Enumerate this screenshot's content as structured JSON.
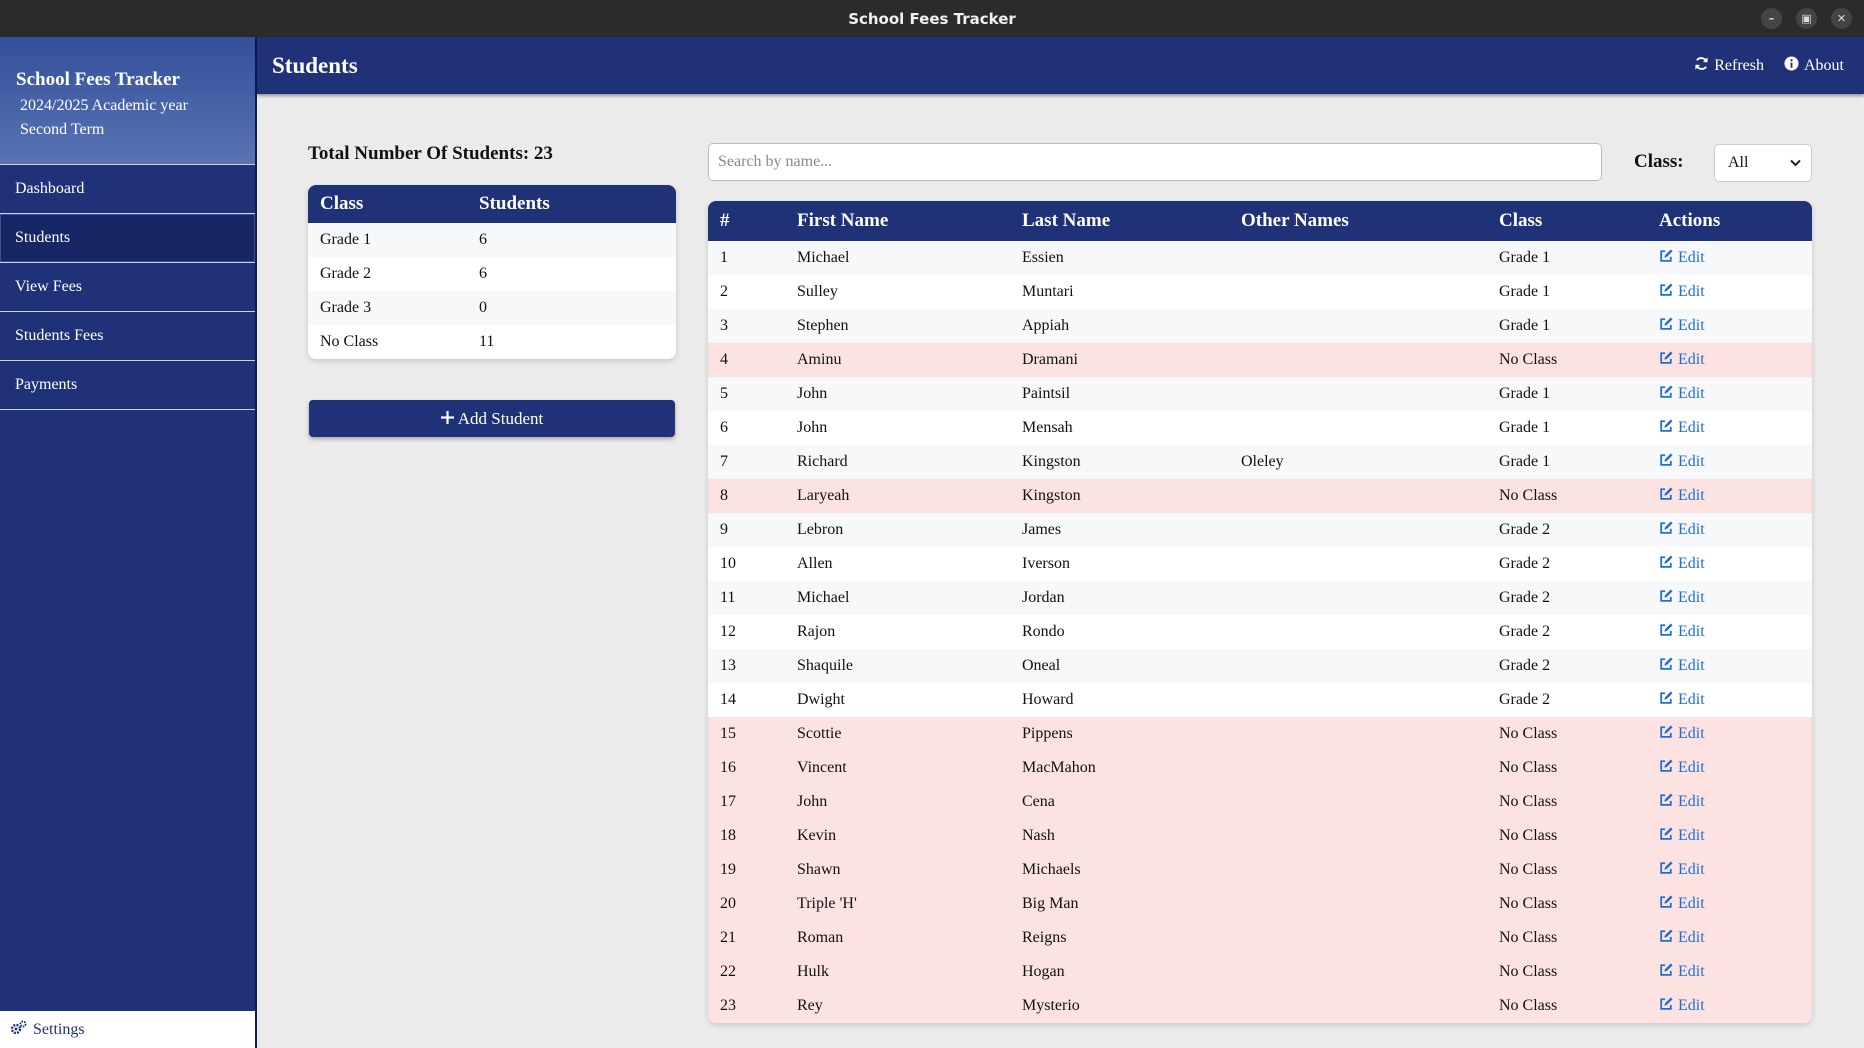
{
  "window": {
    "title": "School Fees Tracker"
  },
  "sidebar": {
    "title": "School Fees Tracker",
    "academic_year": "2024/2025 Academic year",
    "term": "Second Term",
    "items": [
      {
        "label": "Dashboard"
      },
      {
        "label": "Students",
        "active": true
      },
      {
        "label": "View Fees"
      },
      {
        "label": "Students Fees"
      },
      {
        "label": "Payments"
      }
    ],
    "settings_label": "Settings"
  },
  "header": {
    "title": "Students",
    "refresh_label": "Refresh",
    "about_label": "About"
  },
  "summary": {
    "total_label": "Total Number Of Students: 23",
    "columns": [
      "Class",
      "Students"
    ],
    "rows": [
      {
        "class": "Grade 1",
        "count": "6"
      },
      {
        "class": "Grade 2",
        "count": "6"
      },
      {
        "class": "Grade 3",
        "count": "0"
      },
      {
        "class": "No Class",
        "count": "11"
      }
    ],
    "add_button_label": "Add Student"
  },
  "filters": {
    "search_placeholder": "Search by name...",
    "class_label": "Class:",
    "class_selected": "All"
  },
  "students_table": {
    "columns": [
      "#",
      "First Name",
      "Last Name",
      "Other Names",
      "Class",
      "Actions"
    ],
    "edit_label": "Edit",
    "rows": [
      {
        "num": "1",
        "first": "Michael",
        "last": "Essien",
        "other": "",
        "class": "Grade 1"
      },
      {
        "num": "2",
        "first": "Sulley",
        "last": "Muntari",
        "other": "",
        "class": "Grade 1"
      },
      {
        "num": "3",
        "first": "Stephen",
        "last": "Appiah",
        "other": "",
        "class": "Grade 1"
      },
      {
        "num": "4",
        "first": "Aminu",
        "last": "Dramani",
        "other": "",
        "class": "No Class"
      },
      {
        "num": "5",
        "first": "John",
        "last": "Paintsil",
        "other": "",
        "class": "Grade 1"
      },
      {
        "num": "6",
        "first": "John",
        "last": "Mensah",
        "other": "",
        "class": "Grade 1"
      },
      {
        "num": "7",
        "first": "Richard",
        "last": "Kingston",
        "other": "Oleley",
        "class": "Grade 1"
      },
      {
        "num": "8",
        "first": "Laryeah",
        "last": "Kingston",
        "other": "",
        "class": "No Class"
      },
      {
        "num": "9",
        "first": "Lebron",
        "last": "James",
        "other": "",
        "class": "Grade 2"
      },
      {
        "num": "10",
        "first": "Allen",
        "last": "Iverson",
        "other": "",
        "class": "Grade 2"
      },
      {
        "num": "11",
        "first": "Michael",
        "last": "Jordan",
        "other": "",
        "class": "Grade 2"
      },
      {
        "num": "12",
        "first": "Rajon",
        "last": "Rondo",
        "other": "",
        "class": "Grade 2"
      },
      {
        "num": "13",
        "first": "Shaquile",
        "last": "Oneal",
        "other": "",
        "class": "Grade 2"
      },
      {
        "num": "14",
        "first": "Dwight",
        "last": "Howard",
        "other": "",
        "class": "Grade 2"
      },
      {
        "num": "15",
        "first": "Scottie",
        "last": "Pippens",
        "other": "",
        "class": "No Class"
      },
      {
        "num": "16",
        "first": "Vincent",
        "last": "MacMahon",
        "other": "",
        "class": "No Class"
      },
      {
        "num": "17",
        "first": "John",
        "last": "Cena",
        "other": "",
        "class": "No Class"
      },
      {
        "num": "18",
        "first": "Kevin",
        "last": "Nash",
        "other": "",
        "class": "No Class"
      },
      {
        "num": "19",
        "first": "Shawn",
        "last": "Michaels",
        "other": "",
        "class": "No Class"
      },
      {
        "num": "20",
        "first": "Triple 'H'",
        "last": "Big Man",
        "other": "",
        "class": "No Class"
      },
      {
        "num": "21",
        "first": "Roman",
        "last": "Reigns",
        "other": "",
        "class": "No Class"
      },
      {
        "num": "22",
        "first": "Hulk",
        "last": "Hogan",
        "other": "",
        "class": "No Class"
      },
      {
        "num": "23",
        "first": "Rey",
        "last": "Mysterio",
        "other": "",
        "class": "No Class"
      }
    ]
  },
  "colors": {
    "primary": "#1f3278",
    "no_class_row": "#fde2e2",
    "link": "#1e6fd0"
  }
}
